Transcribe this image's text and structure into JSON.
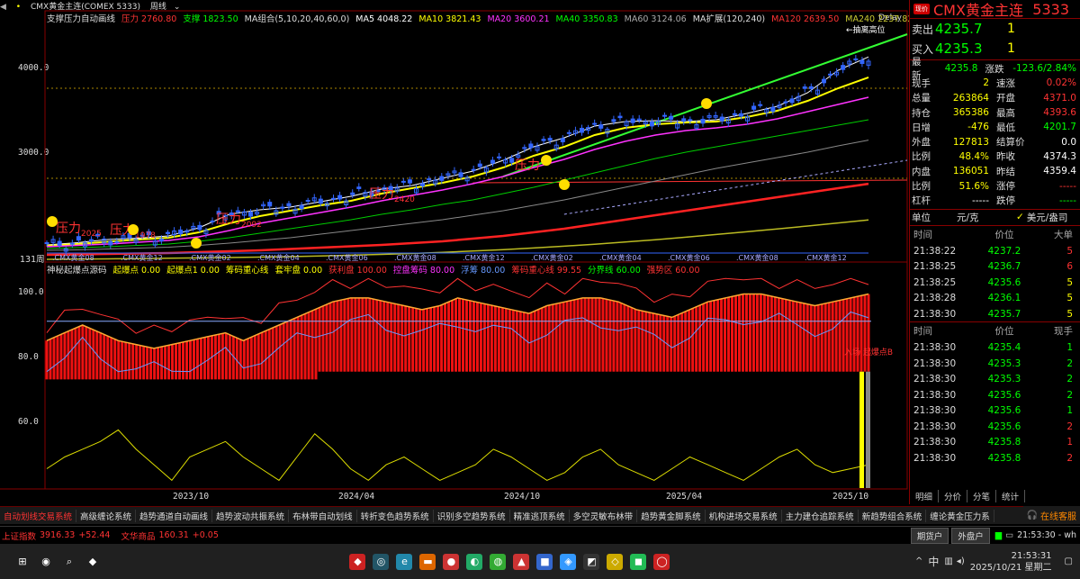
{
  "chart_header": {
    "symbol": "CMX黄金主连(COMEX 5333)",
    "period": "周线",
    "delay": "Delay"
  },
  "legend_main": [
    {
      "label": "支撑压力自动画线",
      "color": "#dddddd"
    },
    {
      "label": "压力 2760.80",
      "color": "#ff3333"
    },
    {
      "label": "支撑 1823.50",
      "color": "#00ff00"
    },
    {
      "label": "MA组合(5,10,20,40,60,0)",
      "color": "#dddddd"
    },
    {
      "label": "MA5 4048.22",
      "color": "#ffffff"
    },
    {
      "label": "MA10 3821.43",
      "color": "#ffff00"
    },
    {
      "label": "MA20 3600.21",
      "color": "#ff33ff"
    },
    {
      "label": "MA40 3350.83",
      "color": "#00ff00"
    },
    {
      "label": "MA60 3124.06",
      "color": "#aaaaaa"
    },
    {
      "label": "MA扩展(120,240)",
      "color": "#dddddd"
    },
    {
      "label": "MA120 2639.50",
      "color": "#ff3333"
    },
    {
      "label": "MA240 2237.82",
      "color": "#cccc33"
    }
  ],
  "legend_sub": [
    {
      "label": "神秘起爆点源码",
      "color": "#dddddd"
    },
    {
      "label": "起爆点 0.00",
      "color": "#ffff00"
    },
    {
      "label": "起爆点1 0.00",
      "color": "#ffff00"
    },
    {
      "label": "筹码重心线",
      "color": "#ffff00"
    },
    {
      "label": "套牢盘 0.00",
      "color": "#ffff00"
    },
    {
      "label": "获利盘 100.00",
      "color": "#ff3333"
    },
    {
      "label": "控盘筹码 80.00",
      "color": "#ff33ff"
    },
    {
      "label": "浮筹 80.00",
      "color": "#6699ff"
    },
    {
      "label": "筹码重心线 99.55",
      "color": "#ff3333"
    },
    {
      "label": "分界线 60.00",
      "color": "#00ff00"
    },
    {
      "label": "强势区 60.00",
      "color": "#ff3333"
    }
  ],
  "y_axis_main": [
    "4000.0",
    "3000.0"
  ],
  "y_axis_sub": [
    "100.0",
    "80.0",
    "60.0"
  ],
  "x_axis": [
    "2023/10",
    "2024/04",
    "2024/10",
    "2025/04",
    "2025/10"
  ],
  "period_label": "131周",
  "annotations": {
    "pressure": [
      {
        "text": "压力",
        "value": "2025"
      },
      {
        "text": "压力",
        "value": "1978"
      },
      {
        "text": "压力",
        "value": "2092"
      },
      {
        "text": "压力",
        "value": "2420"
      },
      {
        "text": "压力",
        "value": ""
      }
    ],
    "contract_labels": [
      ".CMX黄金08",
      ".CMX黄金12",
      ".CMX黄金02",
      ".CMX黄金04",
      ".CMX黄金06",
      ".CMX黄金08",
      ".CMX黄金12",
      ".CMX黄金02",
      ".CMX黄金04",
      ".CMX黄金06",
      ".CMX黄金08",
      ".CMX黄金12"
    ],
    "sub_marker": "入场 起爆点B",
    "top_marker": "←抽离高位"
  },
  "chart_data": [
    {
      "type": "line",
      "title": "CMX黄金主连 周线",
      "ylim": [
        1800,
        4400
      ],
      "series": [
        {
          "name": "MA5",
          "values": [
            1960,
            1985,
            2020,
            2035,
            2060,
            2150,
            2300,
            2350,
            2380,
            2440,
            2500,
            2580,
            2620,
            2700,
            2780,
            2900,
            3050,
            3150,
            3280,
            3330,
            3340,
            3330,
            3350,
            3420,
            3500,
            3650,
            3900,
            4048
          ]
        },
        {
          "name": "MA10",
          "values": [
            1950,
            1970,
            1995,
            2020,
            2040,
            2100,
            2200,
            2280,
            2340,
            2400,
            2450,
            2530,
            2590,
            2650,
            2720,
            2820,
            2950,
            3050,
            3180,
            3260,
            3300,
            3320,
            3330,
            3380,
            3450,
            3560,
            3700,
            3821
          ]
        },
        {
          "name": "MA20",
          "values": [
            1940,
            1955,
            1970,
            1990,
            2010,
            2050,
            2120,
            2200,
            2260,
            2320,
            2380,
            2450,
            2510,
            2570,
            2640,
            2720,
            2820,
            2910,
            3020,
            3110,
            3180,
            3230,
            3260,
            3300,
            3360,
            3440,
            3520,
            3600
          ]
        },
        {
          "name": "MA40",
          "values": [
            1920,
            1930,
            1940,
            1955,
            1970,
            2000,
            2040,
            2090,
            2140,
            2190,
            2240,
            2300,
            2350,
            2410,
            2460,
            2530,
            2600,
            2680,
            2760,
            2840,
            2920,
            2990,
            3050,
            3110,
            3170,
            3230,
            3290,
            3350
          ]
        },
        {
          "name": "MA60",
          "values": [
            1900,
            1905,
            1915,
            1925,
            1935,
            1955,
            1980,
            2010,
            2040,
            2080,
            2120,
            2160,
            2200,
            2240,
            2290,
            2340,
            2400,
            2460,
            2530,
            2600,
            2670,
            2740,
            2810,
            2870,
            2930,
            2990,
            3060,
            3124
          ]
        },
        {
          "name": "MA120",
          "values": [
            1850,
            1855,
            1860,
            1865,
            1870,
            1880,
            1890,
            1900,
            1915,
            1930,
            1945,
            1960,
            1980,
            2000,
            2030,
            2060,
            2100,
            2140,
            2190,
            2240,
            2290,
            2340,
            2390,
            2440,
            2490,
            2540,
            2590,
            2639
          ]
        },
        {
          "name": "MA240",
          "values": [
            1800,
            1802,
            1805,
            1808,
            1812,
            1816,
            1820,
            1825,
            1830,
            1838,
            1846,
            1855,
            1865,
            1878,
            1892,
            1908,
            1926,
            1946,
            1968,
            1992,
            2018,
            2046,
            2076,
            2106,
            2138,
            2170,
            2204,
            2237
          ]
        }
      ]
    },
    {
      "type": "area",
      "title": "神秘起爆点源码",
      "ylim": [
        50,
        105
      ],
      "series": [
        {
          "name": "获利盘",
          "values": [
            88,
            90,
            92,
            90,
            88,
            87,
            86,
            87,
            88,
            89,
            90,
            88,
            90,
            92,
            94,
            96,
            98,
            99,
            99,
            98,
            97,
            96,
            97,
            99,
            98,
            97,
            96,
            95,
            97,
            98,
            99,
            99,
            98,
            96,
            95,
            94,
            96,
            98,
            99,
            100,
            100,
            99,
            98,
            97,
            98,
            99,
            100
          ]
        },
        {
          "name": "套牢盘",
          "values": [
            55,
            58,
            60,
            62,
            65,
            60,
            56,
            52,
            58,
            60,
            62,
            58,
            55,
            52,
            58,
            64,
            60,
            55,
            52,
            56,
            58,
            55,
            52,
            54,
            56,
            60,
            58,
            55,
            52,
            54,
            58,
            60,
            56,
            54,
            52,
            55,
            58,
            56,
            54,
            52,
            55,
            58,
            60,
            56,
            54,
            55,
            56
          ]
        }
      ]
    }
  ],
  "quote": {
    "badge": "现价",
    "name": "CMX黄金主连",
    "code": "5333",
    "sell_label": "卖出",
    "sell_price": "4235.7",
    "sell_vol": "1",
    "buy_label": "买入",
    "buy_price": "4235.3",
    "buy_vol": "1",
    "rows": [
      {
        "k": "最新",
        "v": "4235.8",
        "vc": "#00ff00",
        "k2": "涨跌",
        "v2": "-123.6/2.84%",
        "v2c": "#00ff00"
      },
      {
        "k": "现手",
        "v": "2",
        "vc": "#ffff00",
        "k2": "速涨",
        "v2": "0.02%",
        "v2c": "#ff3333"
      },
      {
        "k": "总量",
        "v": "263864",
        "vc": "#ffff00",
        "k2": "开盘",
        "v2": "4371.0",
        "v2c": "#ff3333"
      },
      {
        "k": "持仓",
        "v": "365386",
        "vc": "#ffff00",
        "k2": "最高",
        "v2": "4393.6",
        "v2c": "#ff3333"
      },
      {
        "k": "日增",
        "v": "-476",
        "vc": "#ffff00",
        "k2": "最低",
        "v2": "4201.7",
        "v2c": "#00ff00"
      },
      {
        "k": "外盘",
        "v": "127813",
        "vc": "#ffff00",
        "k2": "结算价",
        "v2": "0.0",
        "v2c": "#ffffff"
      },
      {
        "k": "比例",
        "v": "48.4%",
        "vc": "#ffff00",
        "k2": "昨收",
        "v2": "4374.3",
        "v2c": "#ffffff"
      },
      {
        "k": "内盘",
        "v": "136051",
        "vc": "#ffff00",
        "k2": "昨结",
        "v2": "4359.4",
        "v2c": "#ffffff"
      },
      {
        "k": "比例",
        "v": "51.6%",
        "vc": "#ffff00",
        "k2": "涨停",
        "v2": "-----",
        "v2c": "#ff3333"
      },
      {
        "k": "杠杆",
        "v": "-----",
        "vc": "#ffffff",
        "k2": "跌停",
        "v2": "-----",
        "v2c": "#00ff00"
      }
    ],
    "unit_label": "单位",
    "unit_value": "元/克",
    "unit_alt": "美元/盎司"
  },
  "ticks1": {
    "head": [
      "时间",
      "价位",
      "大单"
    ],
    "rows": [
      {
        "t": "21:38:22",
        "p": "4237.2",
        "v": "5",
        "vc": "#ff3333"
      },
      {
        "t": "21:38:25",
        "p": "4236.7",
        "v": "6",
        "vc": "#ff3333"
      },
      {
        "t": "21:38:25",
        "p": "4235.6",
        "v": "5",
        "vc": "#ffff00"
      },
      {
        "t": "21:38:28",
        "p": "4236.1",
        "v": "5",
        "vc": "#ffff00"
      },
      {
        "t": "21:38:30",
        "p": "4235.7",
        "v": "5",
        "vc": "#ffff00"
      }
    ]
  },
  "ticks2": {
    "head": [
      "时间",
      "价位",
      "现手"
    ],
    "rows": [
      {
        "t": "21:38:30",
        "p": "4235.4",
        "v": "1",
        "vc": "#00ff00"
      },
      {
        "t": "21:38:30",
        "p": "4235.3",
        "v": "2",
        "vc": "#00ff00"
      },
      {
        "t": "21:38:30",
        "p": "4235.3",
        "v": "2",
        "vc": "#00ff00"
      },
      {
        "t": "21:38:30",
        "p": "4235.6",
        "v": "2",
        "vc": "#00ff00"
      },
      {
        "t": "21:38:30",
        "p": "4235.6",
        "v": "1",
        "vc": "#00ff00"
      },
      {
        "t": "21:38:30",
        "p": "4235.6",
        "v": "2",
        "vc": "#ff3333"
      },
      {
        "t": "21:38:30",
        "p": "4235.8",
        "v": "1",
        "vc": "#ff3333"
      },
      {
        "t": "21:38:30",
        "p": "4235.8",
        "v": "2",
        "vc": "#ff3333"
      }
    ]
  },
  "rp_tabs": [
    "明细",
    "分价",
    "分笔",
    "统计"
  ],
  "bottom_tabs": [
    "自动划线交易系统",
    "高级缠论系统",
    "趋势通道自动画线",
    "趋势波动共振系统",
    "布林带自动划线",
    "转折变色趋势系统",
    "识别多空趋势系统",
    "精准逃顶系统",
    "多空灵敏布林带",
    "趋势黄金脚系统",
    "机构进场交易系统",
    "主力建仓追踪系统",
    "新趋势组合系统",
    "缠论黄金压力系"
  ],
  "online_label": "在线客服",
  "status": {
    "index1_name": "上证指数",
    "index1_val": "3916.33",
    "index1_chg": "+52.44",
    "index2_name": "文华商品",
    "index2_val": "160.31",
    "index2_chg": "+0.05",
    "btn1": "期货户",
    "btn2": "外盘户",
    "time": "21:53:30 - wh"
  },
  "taskbar": {
    "clock_time": "21:53:31",
    "clock_date": "2025/10/21 星期二",
    "ime": "中"
  }
}
